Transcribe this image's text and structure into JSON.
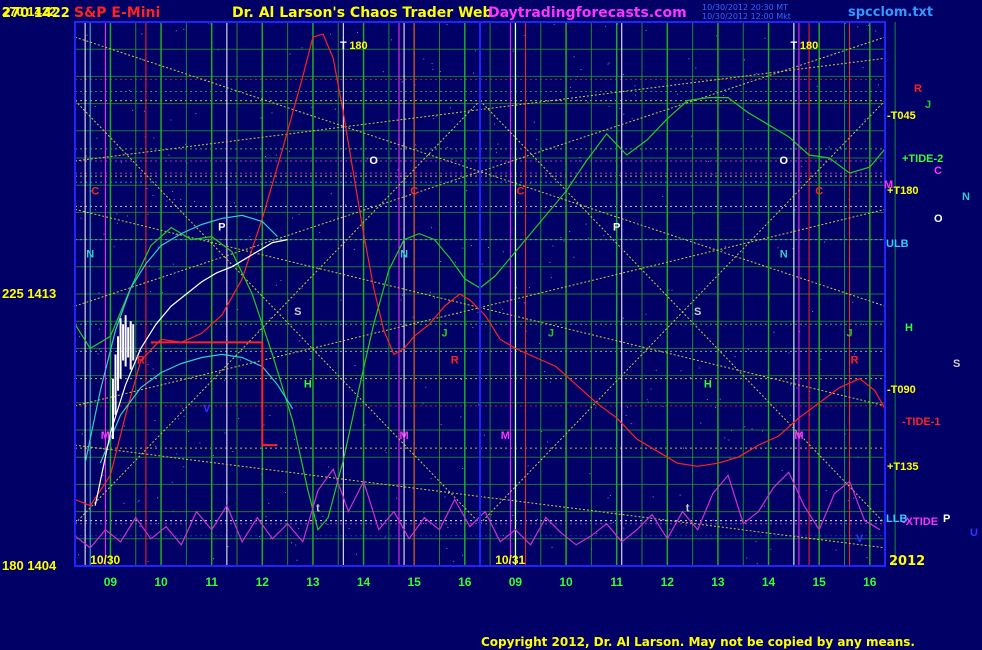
{
  "header": {
    "left_scale": "270 1422",
    "symbol": "S&P E-Mini",
    "title": "Dr. Al Larson's Chaos Trader Web",
    "site": "Daytradingforecasts.com",
    "timestamp1": "10/30/2012 20:30 MT",
    "timestamp2": "10/30/2012 12:00 Mkt",
    "file": "spcclom.txt"
  },
  "footer": {
    "copyright": "Copyright 2012, Dr. Al Larson. May not be copied by any means.",
    "year": "2012"
  },
  "colors": {
    "background": "#000066",
    "frame": "#2222ff",
    "grid": "#22aa22",
    "diag": "#cccc33",
    "price": "#ff2222",
    "tide": "#22cc22",
    "cyan_line": "#33cccc",
    "magenta_line": "#cc33cc",
    "white_line": "#ffffff",
    "label_yellow": "#ffff00"
  },
  "chart_data": {
    "type": "line",
    "title": "S&P E-Mini",
    "y_axis_labels": [
      {
        "angle": "270",
        "price": 1422
      },
      {
        "angle": "225",
        "price": 1413
      },
      {
        "angle": "180",
        "price": 1404
      }
    ],
    "ylim": [
      1404,
      1422
    ],
    "date_labels": [
      "10/30",
      "10/31"
    ],
    "x_ticks": [
      "09",
      "10",
      "11",
      "12",
      "13",
      "14",
      "15",
      "16",
      "09",
      "10",
      "11",
      "12",
      "13",
      "14",
      "15",
      "16"
    ],
    "x_range_hours": [
      8.3,
      24.3
    ],
    "right_labels": [
      {
        "text": "R",
        "price": 1420.1,
        "color": "#ff2222"
      },
      {
        "text": "J",
        "price": 1419.7,
        "color": "#22cc22"
      },
      {
        "text": "-T045",
        "price": 1419.4,
        "color": "#ffff00"
      },
      {
        "text": "+TIDE-2",
        "price": 1417.8,
        "color": "#33ff33"
      },
      {
        "text": "C",
        "price": 1417.4,
        "color": "#ff33ff"
      },
      {
        "text": "M",
        "price": 1417.0,
        "color": "#ff33ff"
      },
      {
        "text": "+T180",
        "price": 1416.9,
        "color": "#ffff00"
      },
      {
        "text": "N",
        "price": 1416.7,
        "color": "#33cccc"
      },
      {
        "text": "O",
        "price": 1415.9,
        "color": "#ffffff"
      },
      {
        "text": "ULB",
        "price": 1414.8,
        "color": "#33ccff"
      },
      {
        "text": "H",
        "price": 1412.0,
        "color": "#33ff33"
      },
      {
        "text": "S",
        "price": 1411.1,
        "color": "#cccccc"
      },
      {
        "text": "-T090",
        "price": 1410.2,
        "color": "#ffff00"
      },
      {
        "text": "-TIDE-1",
        "price": 1409.3,
        "color": "#ff2222"
      },
      {
        "text": "+T135",
        "price": 1407.9,
        "color": "#ffff00"
      },
      {
        "text": "LLB",
        "price": 1405.5,
        "color": "#33ccff"
      },
      {
        "text": "-XTIDE",
        "price": 1405.4,
        "color": "#ff33ff"
      },
      {
        "text": "P",
        "price": 1405.5,
        "color": "#ffffff"
      },
      {
        "text": "U",
        "price": 1405.0,
        "color": "#3333ff"
      }
    ],
    "in_chart_labels": [
      {
        "text": "T",
        "x": 13.6,
        "price": 1421.1,
        "color": "#ffffff"
      },
      {
        "text": "180",
        "x": 13.9,
        "price": 1421.1,
        "color": "#ffff00"
      },
      {
        "text": "T",
        "x": 22.5,
        "price": 1421.1,
        "color": "#ffffff"
      },
      {
        "text": "180",
        "x": 22.8,
        "price": 1421.1,
        "color": "#ffff00"
      },
      {
        "text": "O",
        "x": 14.2,
        "price": 1417.3,
        "color": "#ffffff"
      },
      {
        "text": "O",
        "x": 22.3,
        "price": 1417.3,
        "color": "#ffffff"
      },
      {
        "text": "C",
        "x": 8.7,
        "price": 1416.3,
        "color": "#ff2222"
      },
      {
        "text": "C",
        "x": 15.0,
        "price": 1416.3,
        "color": "#ff2222"
      },
      {
        "text": "C",
        "x": 17.1,
        "price": 1416.3,
        "color": "#ff2222"
      },
      {
        "text": "C",
        "x": 23.0,
        "price": 1416.3,
        "color": "#ff2222"
      },
      {
        "text": "P",
        "x": 11.2,
        "price": 1415.1,
        "color": "#ffffff"
      },
      {
        "text": "P",
        "x": 19.0,
        "price": 1415.1,
        "color": "#ffffff"
      },
      {
        "text": "N",
        "x": 8.6,
        "price": 1414.2,
        "color": "#33cccc"
      },
      {
        "text": "N",
        "x": 14.8,
        "price": 1414.2,
        "color": "#33cccc"
      },
      {
        "text": "N",
        "x": 22.3,
        "price": 1414.2,
        "color": "#33cccc"
      },
      {
        "text": "S",
        "x": 12.7,
        "price": 1412.3,
        "color": "#cccccc"
      },
      {
        "text": "S",
        "x": 20.6,
        "price": 1412.3,
        "color": "#cccccc"
      },
      {
        "text": "J",
        "x": 15.6,
        "price": 1411.6,
        "color": "#22cc22"
      },
      {
        "text": "J",
        "x": 17.7,
        "price": 1411.6,
        "color": "#22cc22"
      },
      {
        "text": "J",
        "x": 23.6,
        "price": 1411.6,
        "color": "#22cc22"
      },
      {
        "text": "R",
        "x": 9.6,
        "price": 1410.7,
        "color": "#ff2222"
      },
      {
        "text": "R",
        "x": 15.8,
        "price": 1410.7,
        "color": "#ff2222"
      },
      {
        "text": "R",
        "x": 23.7,
        "price": 1410.7,
        "color": "#ff2222"
      },
      {
        "text": "H",
        "x": 12.9,
        "price": 1409.9,
        "color": "#33ff33"
      },
      {
        "text": "H",
        "x": 20.8,
        "price": 1409.9,
        "color": "#33ff33"
      },
      {
        "text": "V",
        "x": 10.9,
        "price": 1409.1,
        "color": "#3333ff"
      },
      {
        "text": "M",
        "x": 8.9,
        "price": 1408.2,
        "color": "#ff33ff"
      },
      {
        "text": "M",
        "x": 14.8,
        "price": 1408.2,
        "color": "#ff33ff"
      },
      {
        "text": "M",
        "x": 16.8,
        "price": 1408.2,
        "color": "#ff33ff"
      },
      {
        "text": "M",
        "x": 22.6,
        "price": 1408.2,
        "color": "#ff33ff"
      },
      {
        "text": "t",
        "x": 13.1,
        "price": 1405.8,
        "color": "#cccccc"
      },
      {
        "text": "t",
        "x": 20.4,
        "price": 1405.8,
        "color": "#cccccc"
      },
      {
        "text": "V",
        "x": 23.8,
        "price": 1404.8,
        "color": "#3333ff"
      }
    ],
    "series": [
      {
        "name": "price",
        "color": "#ff2222",
        "x": [
          8.3,
          8.6,
          9.0,
          9.3,
          9.6,
          10.0,
          10.4,
          10.8,
          11.2,
          11.6,
          12.0,
          12.4,
          12.8,
          13.0,
          13.2,
          13.4,
          13.6,
          13.8,
          14.0,
          14.2,
          14.4,
          14.6,
          14.8,
          15.0,
          15.3,
          15.6,
          15.9,
          16.1,
          16.4,
          16.7,
          17.0,
          17.4,
          17.8,
          18.2,
          18.6,
          19.0,
          19.4,
          19.8,
          20.2,
          20.6,
          21.0,
          21.4,
          21.8,
          22.2,
          22.6,
          23.0,
          23.4,
          23.8,
          24.1,
          24.3
        ],
        "y": [
          1406.2,
          1406.0,
          1407.0,
          1409.0,
          1410.8,
          1411.5,
          1411.4,
          1411.7,
          1412.3,
          1413.5,
          1415.5,
          1417.8,
          1420.2,
          1421.5,
          1421.6,
          1420.8,
          1419.0,
          1417.0,
          1415.0,
          1413.2,
          1411.8,
          1411.0,
          1411.2,
          1411.6,
          1412.0,
          1412.6,
          1413.0,
          1412.8,
          1412.3,
          1411.5,
          1411.2,
          1410.9,
          1410.6,
          1410.0,
          1409.4,
          1408.9,
          1408.2,
          1407.8,
          1407.4,
          1407.3,
          1407.4,
          1407.6,
          1408.0,
          1408.3,
          1408.9,
          1409.4,
          1409.9,
          1410.2,
          1409.8,
          1409.2
        ]
      },
      {
        "name": "tide",
        "color": "#22cc22",
        "x": [
          8.3,
          8.6,
          9.0,
          9.4,
          9.8,
          10.2,
          10.6,
          11.0,
          11.4,
          11.8,
          12.2,
          12.6,
          12.9,
          13.1,
          13.3,
          13.6,
          13.9,
          14.2,
          14.5,
          14.8,
          15.1,
          15.4,
          15.7,
          16.0,
          16.3,
          16.6,
          16.9,
          17.2,
          17.6,
          18.0,
          18.4,
          18.8,
          19.2,
          19.6,
          20.0,
          20.4,
          20.8,
          21.2,
          21.6,
          22.0,
          22.4,
          22.8,
          23.2,
          23.6,
          24.0,
          24.3
        ],
        "y": [
          1412.0,
          1411.2,
          1411.6,
          1413.2,
          1414.6,
          1415.2,
          1414.8,
          1414.9,
          1414.4,
          1413.0,
          1411.0,
          1408.8,
          1406.5,
          1405.2,
          1405.6,
          1407.5,
          1409.8,
          1412.0,
          1413.8,
          1414.8,
          1415.0,
          1414.8,
          1414.2,
          1413.5,
          1413.2,
          1413.6,
          1414.2,
          1414.8,
          1415.6,
          1416.4,
          1417.4,
          1418.3,
          1417.6,
          1418.1,
          1418.8,
          1419.4,
          1419.5,
          1419.5,
          1419.0,
          1418.6,
          1418.2,
          1417.6,
          1417.5,
          1417.0,
          1417.2,
          1417.8
        ]
      },
      {
        "name": "cyan",
        "color": "#33cccc",
        "x": [
          8.5,
          8.8,
          9.1,
          9.4,
          9.7,
          10.0,
          10.4,
          10.8,
          11.2,
          11.6,
          12.0,
          12.3
        ],
        "y": [
          1407.4,
          1409.8,
          1411.8,
          1413.2,
          1414.0,
          1414.6,
          1415.0,
          1415.3,
          1415.5,
          1415.6,
          1415.4,
          1414.9
        ]
      },
      {
        "name": "cyan2",
        "color": "#33cccc",
        "x": [
          8.8,
          9.2,
          9.6,
          10.0,
          10.4,
          10.8,
          11.2,
          11.6,
          12.0,
          12.3,
          12.6
        ],
        "y": [
          1407.4,
          1409.0,
          1409.9,
          1410.4,
          1410.7,
          1410.9,
          1411.0,
          1410.9,
          1410.6,
          1410.0,
          1409.2
        ]
      },
      {
        "name": "magenta",
        "color": "#cc33cc",
        "x": [
          8.3,
          8.6,
          8.9,
          9.2,
          9.5,
          9.8,
          10.1,
          10.4,
          10.7,
          11.0,
          11.3,
          11.6,
          11.9,
          12.2,
          12.5,
          12.8,
          13.1,
          13.4,
          13.7,
          14.0,
          14.3,
          14.6,
          14.9,
          15.2,
          15.5,
          15.8,
          16.1,
          16.4,
          16.7,
          17.0,
          17.3,
          17.6,
          17.9,
          18.2,
          18.5,
          18.8,
          19.1,
          19.4,
          19.7,
          20.0,
          20.3,
          20.6,
          20.9,
          21.2,
          21.5,
          21.8,
          22.1,
          22.4,
          22.7,
          23.0,
          23.3,
          23.6,
          23.9,
          24.2
        ],
        "y": [
          1405.0,
          1404.6,
          1405.2,
          1404.8,
          1405.6,
          1404.9,
          1405.3,
          1404.7,
          1405.8,
          1405.2,
          1406.0,
          1404.8,
          1405.6,
          1404.9,
          1405.4,
          1404.8,
          1406.5,
          1407.2,
          1405.8,
          1406.8,
          1405.2,
          1405.8,
          1404.9,
          1405.6,
          1405.2,
          1406.2,
          1405.3,
          1405.8,
          1404.8,
          1405.2,
          1404.7,
          1405.6,
          1405.1,
          1404.7,
          1405.0,
          1405.4,
          1404.8,
          1405.2,
          1405.7,
          1404.9,
          1405.8,
          1405.2,
          1406.4,
          1407.0,
          1405.4,
          1405.8,
          1406.6,
          1407.1,
          1406.0,
          1405.2,
          1406.4,
          1406.8,
          1405.5,
          1405.2
        ]
      },
      {
        "name": "white",
        "color": "#ffffff",
        "x": [
          8.7,
          9.0,
          9.3,
          9.6,
          9.9,
          10.2,
          10.5,
          10.8,
          11.1,
          11.4,
          11.7,
          12.0,
          12.2,
          12.5
        ],
        "y": [
          1406.0,
          1408.4,
          1410.0,
          1411.2,
          1412.0,
          1412.6,
          1413.0,
          1413.4,
          1413.7,
          1413.9,
          1414.2,
          1414.5,
          1414.7,
          1414.8
        ]
      },
      {
        "name": "forecast-box",
        "color": "#ff2222",
        "x": [
          9.8,
          12.0,
          12.0,
          12.3
        ],
        "y": [
          1411.4,
          1411.4,
          1408.0,
          1408.0
        ]
      }
    ],
    "bars": {
      "x": [
        9.05,
        9.1,
        9.15,
        9.2,
        9.25,
        9.3,
        9.35,
        9.4,
        9.45
      ],
      "high": [
        1410.2,
        1411.0,
        1411.6,
        1412.2,
        1412.0,
        1412.3,
        1411.9,
        1412.1,
        1412.0
      ],
      "low": [
        1408.2,
        1409.0,
        1409.8,
        1410.2,
        1410.8,
        1410.6,
        1410.9,
        1410.5,
        1410.8
      ]
    }
  }
}
